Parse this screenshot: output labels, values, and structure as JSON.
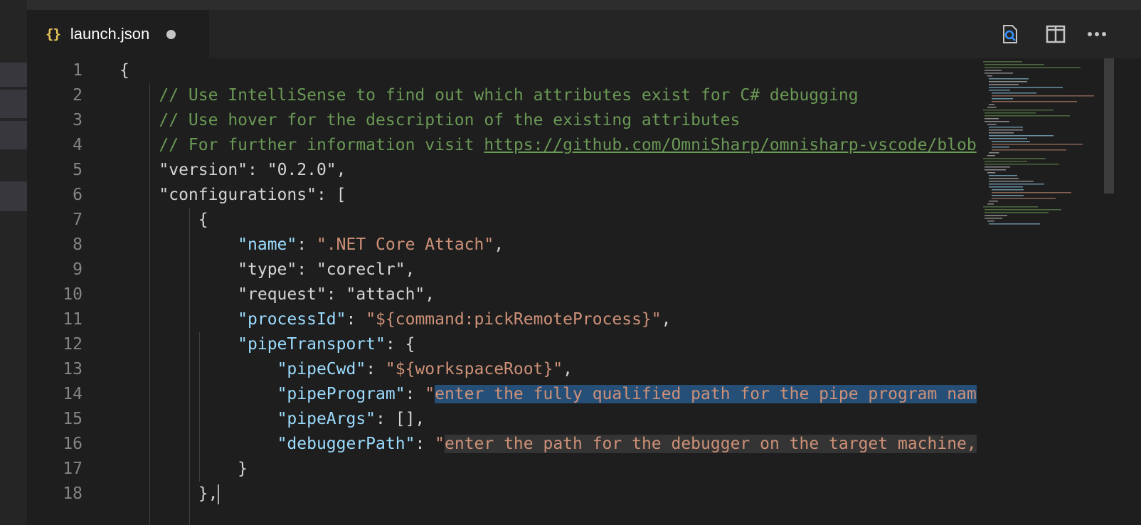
{
  "tab": {
    "icon": "{}",
    "title": "launch.json",
    "dirty_icon": "unsaved-dot-icon"
  },
  "actions": [
    {
      "name": "open-changes-button",
      "icon": "search-file-icon"
    },
    {
      "name": "split-editor-button",
      "icon": "split-editor-icon"
    },
    {
      "name": "more-actions-button",
      "icon": "ellipsis-icon"
    }
  ],
  "lines": [
    {
      "n": "1",
      "parts": [
        [
          "punct",
          "{"
        ]
      ]
    },
    {
      "n": "2",
      "parts": [
        [
          "cmt",
          "    // Use IntelliSense to find out which attributes exist for C# debugging"
        ]
      ]
    },
    {
      "n": "3",
      "parts": [
        [
          "cmt",
          "    // Use hover for the description of the existing attributes"
        ]
      ]
    },
    {
      "n": "4",
      "parts": [
        [
          "cmt",
          "    // For further information visit "
        ],
        [
          "cmt link",
          "https://github.com/OmniSharp/omnisharp-vscode/blob"
        ]
      ]
    },
    {
      "n": "5",
      "parts": [
        [
          "punct",
          "    \"version\": "
        ],
        [
          "punct",
          "\"0.2.0\""
        ],
        [
          "punct",
          ","
        ]
      ]
    },
    {
      "n": "6",
      "parts": [
        [
          "punct",
          "    \"configurations\": ["
        ]
      ]
    },
    {
      "n": "7",
      "parts": [
        [
          "punct",
          "        {"
        ]
      ]
    },
    {
      "n": "8",
      "parts": [
        [
          "punct",
          "            "
        ],
        [
          "key",
          "\"name\""
        ],
        [
          "punct",
          ": "
        ],
        [
          "str",
          "\".NET Core Attach\""
        ],
        [
          "punct",
          ","
        ]
      ]
    },
    {
      "n": "9",
      "parts": [
        [
          "punct",
          "            \"type\": \"coreclr\","
        ]
      ]
    },
    {
      "n": "10",
      "parts": [
        [
          "punct",
          "            \"request\": \"attach\","
        ]
      ]
    },
    {
      "n": "11",
      "parts": [
        [
          "punct",
          "            "
        ],
        [
          "key",
          "\"processId\""
        ],
        [
          "punct",
          ": "
        ],
        [
          "str",
          "\"${command:pickRemoteProcess}\""
        ],
        [
          "punct",
          ","
        ]
      ]
    },
    {
      "n": "12",
      "parts": [
        [
          "punct",
          "            "
        ],
        [
          "key",
          "\"pipeTransport\""
        ],
        [
          "punct",
          ": {"
        ]
      ]
    },
    {
      "n": "13",
      "parts": [
        [
          "punct",
          "                "
        ],
        [
          "key",
          "\"pipeCwd\""
        ],
        [
          "punct",
          ": "
        ],
        [
          "str",
          "\"${workspaceRoot}\""
        ],
        [
          "punct",
          ","
        ]
      ]
    },
    {
      "n": "14",
      "parts": [
        [
          "punct",
          "                "
        ],
        [
          "key",
          "\"pipeProgram\""
        ],
        [
          "punct",
          ": "
        ],
        [
          "str",
          "\""
        ],
        [
          "str selected",
          "enter the fully qualified path for the pipe program nam"
        ]
      ]
    },
    {
      "n": "15",
      "parts": [
        [
          "punct",
          "                "
        ],
        [
          "key",
          "\"pipeArgs\""
        ],
        [
          "punct",
          ": [],"
        ]
      ]
    },
    {
      "n": "16",
      "parts": [
        [
          "punct",
          "                "
        ],
        [
          "key",
          "\"debuggerPath\""
        ],
        [
          "punct",
          ": "
        ],
        [
          "str",
          "\""
        ],
        [
          "str highlight",
          "enter the path for the debugger on the target machine,"
        ]
      ]
    },
    {
      "n": "17",
      "parts": [
        [
          "punct",
          "            }"
        ]
      ]
    },
    {
      "n": "18",
      "parts": [
        [
          "punct",
          "        },"
        ]
      ]
    }
  ]
}
